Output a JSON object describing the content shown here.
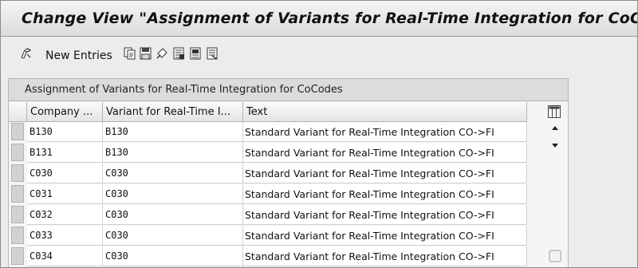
{
  "window": {
    "title": "Change View \"Assignment of Variants for Real-Time Integration for CoCo"
  },
  "toolbar": {
    "new_entries_label": "New Entries",
    "icons": [
      "display-change-icon",
      "new-entries-icon",
      "copy-icon",
      "save-icon",
      "undo-icon",
      "select-all-icon",
      "select-block-icon",
      "deselect-all-icon"
    ]
  },
  "table": {
    "title": "Assignment of Variants for Real-Time Integration for CoCodes",
    "columns": [
      "Company ...",
      "Variant for Real-Time I...",
      "Text"
    ],
    "rows": [
      {
        "company": "B130",
        "variant": "B130",
        "text": "Standard Variant for Real-Time Integration CO->FI"
      },
      {
        "company": "B131",
        "variant": "B130",
        "text": "Standard Variant for Real-Time Integration CO->FI"
      },
      {
        "company": "C030",
        "variant": "C030",
        "text": "Standard Variant for Real-Time Integration CO->FI"
      },
      {
        "company": "C031",
        "variant": "C030",
        "text": "Standard Variant for Real-Time Integration CO->FI"
      },
      {
        "company": "C032",
        "variant": "C030",
        "text": "Standard Variant for Real-Time Integration CO->FI"
      },
      {
        "company": "C033",
        "variant": "C030",
        "text": "Standard Variant for Real-Time Integration CO->FI"
      },
      {
        "company": "C034",
        "variant": "C030",
        "text": "Standard Variant for Real-Time Integration CO->FI"
      }
    ]
  },
  "colors": {
    "title_bg": "#e4e4e4",
    "cell_bg": "#ffffff",
    "header_bg": "#ececec"
  }
}
